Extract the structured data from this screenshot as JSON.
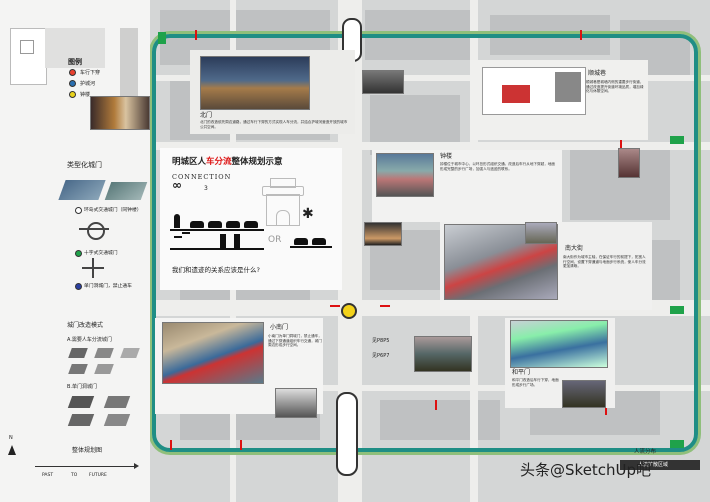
{
  "legend": {
    "title": "图例",
    "items": [
      {
        "label": "车行下穿",
        "color": "#e8402e"
      },
      {
        "label": "护城河",
        "color": "#2a6fb0"
      },
      {
        "label": "钟楼",
        "color": "#e9d21b"
      }
    ]
  },
  "typology": {
    "title": "类型化城门",
    "items": [
      {
        "label": "环岛式交通城门（同钟楼）"
      },
      {
        "label": "十字式交通城门"
      },
      {
        "label": "单门洞城门，禁止通车"
      }
    ]
  },
  "gate_mode": {
    "title": "城门改造模式",
    "a": "A.需要人车分流城门",
    "b": "B.单门洞城门"
  },
  "overall": {
    "title": "整体规划图",
    "past": "PAST",
    "to": "TO",
    "future": "FUTURE"
  },
  "concept": {
    "title_black": "明城区人",
    "title_red": "车分流",
    "title_rest": "整体规划示意",
    "connection": "CONNECTION",
    "num": "3",
    "or": "OR",
    "question": "我们和遗迹的关系应该是什么?"
  },
  "labels": {
    "beimen": "北门",
    "shunchengxiang": "顺城巷",
    "zhonglou": "钟楼",
    "nandajie": "南大街",
    "xiaonanmen": "小南门",
    "hepingmen": "和平门",
    "crowd1": "人流分布",
    "crowd2": "人流扩散区域",
    "callout1": "见P8P5",
    "callout2": "见P6P7"
  },
  "watermark": {
    "prefix": "头条",
    "at": "@",
    "brand": "SketchUp吧"
  }
}
